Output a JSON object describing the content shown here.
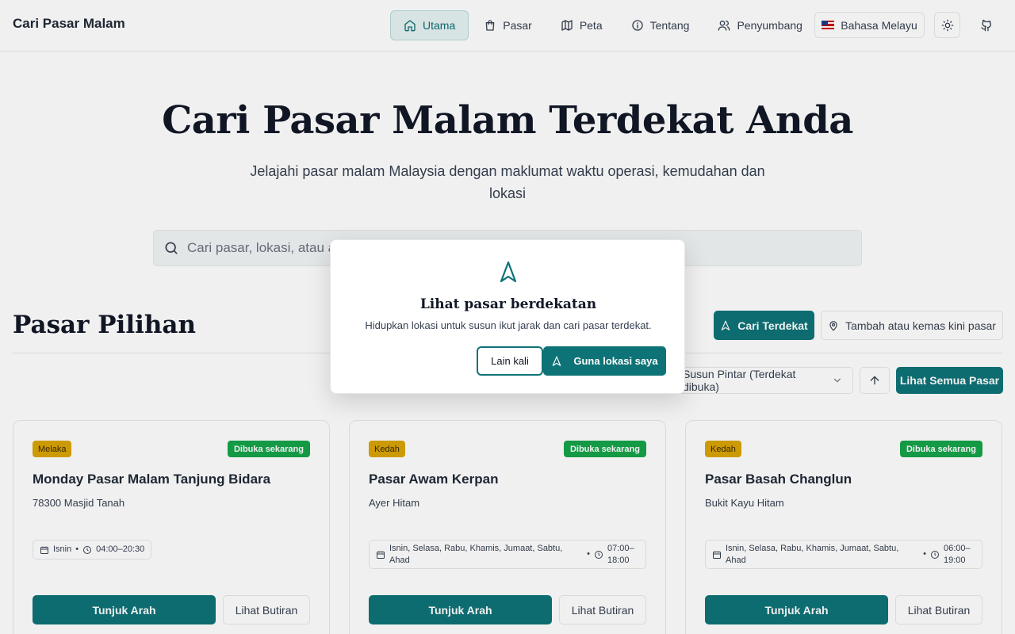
{
  "header": {
    "brand": "Cari Pasar Malam",
    "nav": [
      {
        "label": "Utama",
        "icon": "home-icon"
      },
      {
        "label": "Pasar",
        "icon": "shopping-bag-icon"
      },
      {
        "label": "Peta",
        "icon": "map-icon"
      },
      {
        "label": "Tentang",
        "icon": "info-icon"
      },
      {
        "label": "Penyumbang",
        "icon": "users-icon"
      }
    ],
    "language": "Bahasa Melayu"
  },
  "hero": {
    "title": "Cari Pasar Malam Terdekat Anda",
    "subtitle": "Jelajahi pasar malam Malaysia dengan maklumat waktu operasi, kemudahan dan lokasi"
  },
  "search": {
    "placeholder": "Cari pasar, lokasi, atau alamat..."
  },
  "section": {
    "title": "Pasar Pilihan",
    "nearest_label": "Cari Terdekat",
    "add_label": "Tambah atau kemas kini pasar",
    "sort_label": "Susun Pintar (Terdekat dibuka)",
    "all_label": "Lihat Semua Pasar"
  },
  "cards": [
    {
      "state": "Melaka",
      "status": "Dibuka sekarang",
      "name": "Monday Pasar Malam Tanjung Bidara",
      "location": "78300 Masjid Tanah",
      "days": "Isnin",
      "hours": "04:00–20:30",
      "go_label": "Tunjuk Arah",
      "detail_label": "Lihat Butiran"
    },
    {
      "state": "Kedah",
      "status": "Dibuka sekarang",
      "name": "Pasar Awam Kerpan",
      "location": "Ayer Hitam",
      "days": "Isnin, Selasa, Rabu, Khamis, Jumaat, Sabtu, Ahad",
      "hours": "07:00–18:00",
      "go_label": "Tunjuk Arah",
      "detail_label": "Lihat Butiran"
    },
    {
      "state": "Kedah",
      "status": "Dibuka sekarang",
      "name": "Pasar Basah Changlun",
      "location": "Bukit Kayu Hitam",
      "days": "Isnin, Selasa, Rabu, Khamis, Jumaat, Sabtu, Ahad",
      "hours": "06:00–19:00",
      "go_label": "Tunjuk Arah",
      "detail_label": "Lihat Butiran"
    }
  ],
  "modal": {
    "title": "Lihat pasar berdekatan",
    "text": "Hidupkan lokasi untuk susun ikut jarak dan cari pasar terdekat.",
    "later_label": "Lain kali",
    "use_label": "Guna lokasi saya"
  },
  "colors": {
    "accent": "#0e7377",
    "open_badge": "#16a34a",
    "state_badge": "#d9a406"
  }
}
